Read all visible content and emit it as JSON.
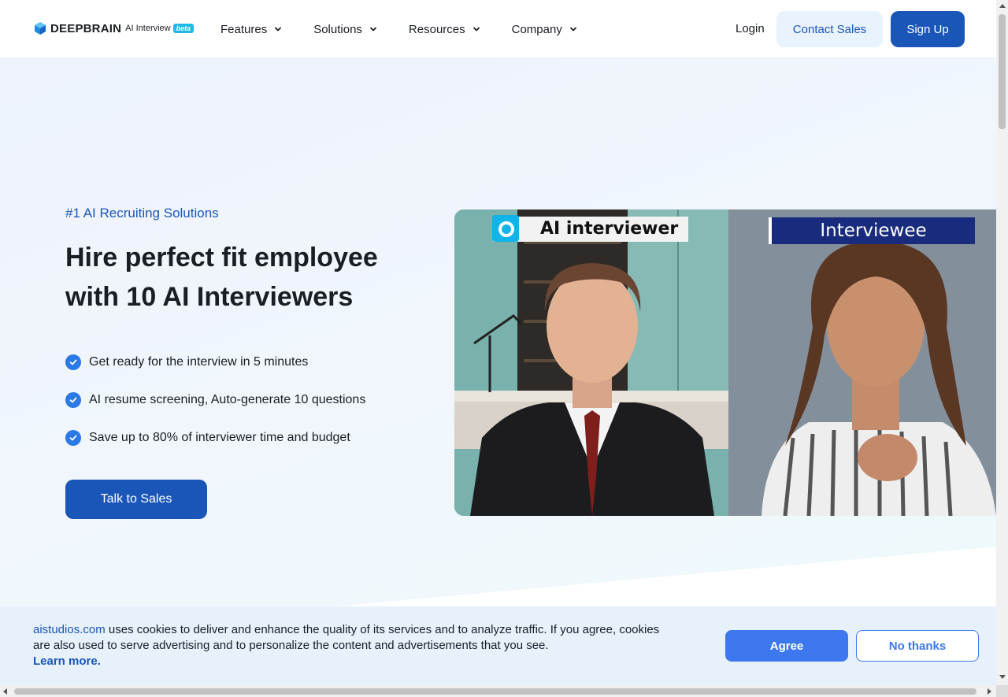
{
  "header": {
    "logo": {
      "brand": "DEEPBRAIN",
      "product": "AI Interview",
      "badge": "beta",
      "icon": "deepbrain-cube-icon"
    },
    "nav": [
      {
        "label": "Features",
        "icon": "chevron-down-icon"
      },
      {
        "label": "Solutions",
        "icon": "chevron-down-icon"
      },
      {
        "label": "Resources",
        "icon": "chevron-down-icon"
      },
      {
        "label": "Company",
        "icon": "chevron-down-icon"
      }
    ],
    "login_label": "Login",
    "contact_label": "Contact Sales",
    "signup_label": "Sign Up"
  },
  "hero": {
    "eyebrow": "#1 AI Recruiting Solutions",
    "headline": "Hire perfect fit employee with 10 AI Interviewers",
    "bullets": [
      "Get ready for the interview in 5 minutes",
      "AI resume screening, Auto-generate 10 questions",
      "Save up to 80% of interviewer time and budget"
    ],
    "bullet_icon": "check-circle-icon",
    "cta_label": "Talk to Sales"
  },
  "video": {
    "left_label": "AI interviewer",
    "right_label": "Interviewee"
  },
  "cookie": {
    "domain": "aistudios.com",
    "message": " uses cookies to deliver and enhance the quality of its services and to analyze traffic. If you agree, cookies are also used to serve advertising and to personalize the content and advertisements that you see.",
    "learn_more": "Learn more.",
    "agree_label": "Agree",
    "decline_label": "No thanks"
  },
  "colors": {
    "primary": "#1a56b8",
    "accent": "#3d78ee",
    "check": "#2a79e6",
    "cookie_bg": "#e6f1fb"
  }
}
